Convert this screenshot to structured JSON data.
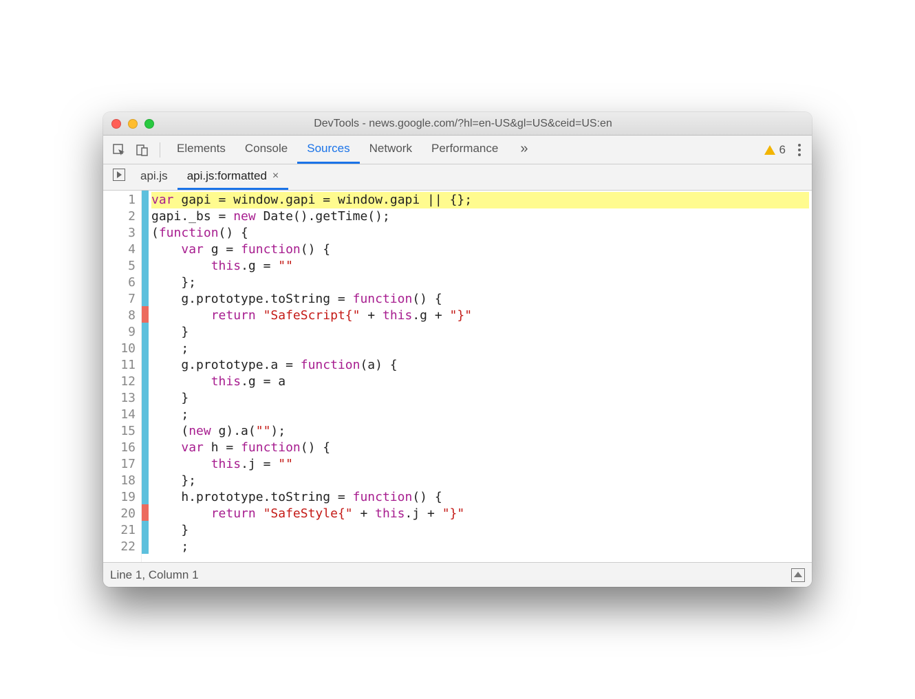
{
  "window": {
    "title": "DevTools - news.google.com/?hl=en-US&gl=US&ceid=US:en"
  },
  "mainTabs": {
    "items": [
      "Elements",
      "Console",
      "Sources",
      "Network",
      "Performance"
    ],
    "activeIndex": 2,
    "overflow": "»",
    "warningCount": "6"
  },
  "fileTabs": {
    "items": [
      {
        "label": "api.js",
        "closable": false
      },
      {
        "label": "api.js:formatted",
        "closable": true
      }
    ],
    "activeIndex": 1
  },
  "editor": {
    "lineCount": 22,
    "markers": [
      "blue",
      "blue",
      "blue",
      "blue",
      "blue",
      "blue",
      "blue",
      "red",
      "blue",
      "blue",
      "blue",
      "blue",
      "blue",
      "blue",
      "blue",
      "blue",
      "blue",
      "blue",
      "blue",
      "red",
      "blue",
      "blue"
    ],
    "highlightedLine": 1,
    "lines": [
      [
        [
          "kw",
          "var"
        ],
        [
          "op",
          " gapi "
        ],
        [
          "op",
          "= "
        ],
        [
          "op",
          "window"
        ],
        [
          "op",
          "."
        ],
        [
          "op",
          "gapi"
        ],
        [
          "op",
          " = "
        ],
        [
          "op",
          "window"
        ],
        [
          "op",
          "."
        ],
        [
          "op",
          "gapi"
        ],
        [
          "op",
          " || {};"
        ]
      ],
      [
        [
          "op",
          "gapi._bs = "
        ],
        [
          "kw",
          "new"
        ],
        [
          "op",
          " Date().getTime();"
        ]
      ],
      [
        [
          "op",
          "("
        ],
        [
          "kw",
          "function"
        ],
        [
          "op",
          "() {"
        ]
      ],
      [
        [
          "op",
          "    "
        ],
        [
          "kw",
          "var"
        ],
        [
          "op",
          " g = "
        ],
        [
          "kw",
          "function"
        ],
        [
          "op",
          "() {"
        ]
      ],
      [
        [
          "op",
          "        "
        ],
        [
          "kw",
          "this"
        ],
        [
          "op",
          ".g = "
        ],
        [
          "str",
          "\"\""
        ]
      ],
      [
        [
          "op",
          "    };"
        ]
      ],
      [
        [
          "op",
          "    g.prototype.toString = "
        ],
        [
          "kw",
          "function"
        ],
        [
          "op",
          "() {"
        ]
      ],
      [
        [
          "op",
          "        "
        ],
        [
          "kw",
          "return"
        ],
        [
          "op",
          " "
        ],
        [
          "str",
          "\"SafeScript{\""
        ],
        [
          "op",
          " + "
        ],
        [
          "kw",
          "this"
        ],
        [
          "op",
          ".g + "
        ],
        [
          "str",
          "\"}\""
        ]
      ],
      [
        [
          "op",
          "    }"
        ]
      ],
      [
        [
          "op",
          "    ;"
        ]
      ],
      [
        [
          "op",
          "    g.prototype.a = "
        ],
        [
          "kw",
          "function"
        ],
        [
          "op",
          "(a) {"
        ]
      ],
      [
        [
          "op",
          "        "
        ],
        [
          "kw",
          "this"
        ],
        [
          "op",
          ".g = a"
        ]
      ],
      [
        [
          "op",
          "    }"
        ]
      ],
      [
        [
          "op",
          "    ;"
        ]
      ],
      [
        [
          "op",
          "    ("
        ],
        [
          "kw",
          "new"
        ],
        [
          "op",
          " g).a("
        ],
        [
          "str",
          "\"\""
        ],
        [
          "op",
          ");"
        ]
      ],
      [
        [
          "op",
          "    "
        ],
        [
          "kw",
          "var"
        ],
        [
          "op",
          " h = "
        ],
        [
          "kw",
          "function"
        ],
        [
          "op",
          "() {"
        ]
      ],
      [
        [
          "op",
          "        "
        ],
        [
          "kw",
          "this"
        ],
        [
          "op",
          ".j = "
        ],
        [
          "str",
          "\"\""
        ]
      ],
      [
        [
          "op",
          "    };"
        ]
      ],
      [
        [
          "op",
          "    h.prototype.toString = "
        ],
        [
          "kw",
          "function"
        ],
        [
          "op",
          "() {"
        ]
      ],
      [
        [
          "op",
          "        "
        ],
        [
          "kw",
          "return"
        ],
        [
          "op",
          " "
        ],
        [
          "str",
          "\"SafeStyle{\""
        ],
        [
          "op",
          " + "
        ],
        [
          "kw",
          "this"
        ],
        [
          "op",
          ".j + "
        ],
        [
          "str",
          "\"}\""
        ]
      ],
      [
        [
          "op",
          "    }"
        ]
      ],
      [
        [
          "op",
          "    ;"
        ]
      ]
    ]
  },
  "statusbar": {
    "position": "Line 1, Column 1"
  }
}
